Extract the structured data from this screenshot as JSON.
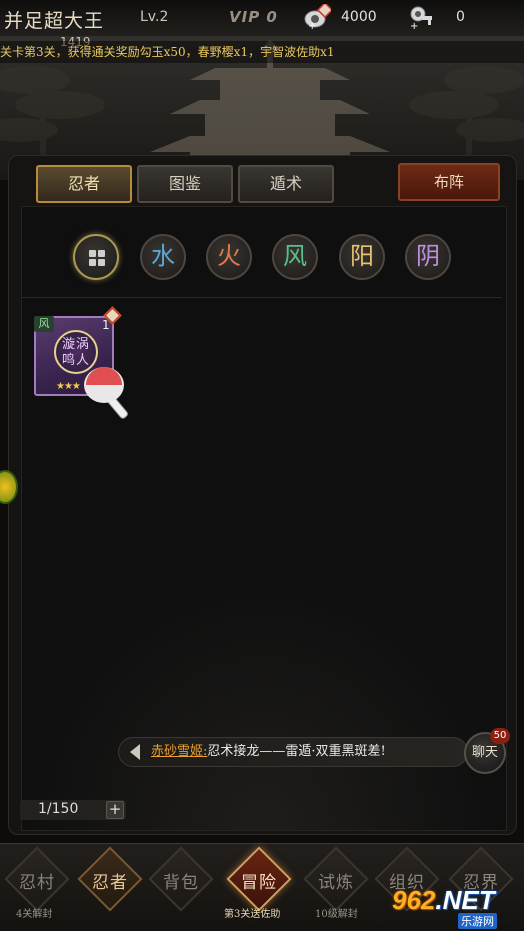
{
  "header": {
    "player_name": "并足超大王",
    "level": "Lv.2",
    "vip": "VIP 0",
    "coupon_icon": "coupon-plus-icon",
    "coupon_value": "4000",
    "key_icon": "key-plus-icon",
    "key_value": "0"
  },
  "marquee": {
    "count": "1419",
    "lead": "关卡第3关",
    "text": "，获得通关奖励勾玉x50，春野樱x1，宇智波佐助x1"
  },
  "tabs": [
    {
      "label": "忍者",
      "active": true
    },
    {
      "label": "图鉴",
      "active": false
    },
    {
      "label": "遁术",
      "active": false
    }
  ],
  "deploy_label": "布阵",
  "filters": [
    {
      "name": "all",
      "icon": "grid-icon",
      "glyph": ""
    },
    {
      "name": "water",
      "glyph": "水",
      "color": "#5aa8d8"
    },
    {
      "name": "fire",
      "glyph": "火",
      "color": "#e07a4a"
    },
    {
      "name": "wind",
      "glyph": "风",
      "color": "#5ac08a"
    },
    {
      "name": "yang",
      "glyph": "阳",
      "color": "#e8c070"
    },
    {
      "name": "yin",
      "glyph": "阴",
      "color": "#c090e0"
    }
  ],
  "ninja_card": {
    "element": "风",
    "level": "1",
    "name": "漩涡鸣人",
    "stars": 3,
    "stars_text": "★★★"
  },
  "chat": {
    "sender": "赤砂雪姬:",
    "message": "忍术接龙——雷遁·双重黑斑差!",
    "button_label": "聊天",
    "badge": "50"
  },
  "capacity": {
    "text": "1/150",
    "plus": "+"
  },
  "bottom_nav": [
    {
      "label": "忍村",
      "sub": "4关解封",
      "state": "normal"
    },
    {
      "label": "忍者",
      "sub": "",
      "state": "highlight"
    },
    {
      "label": "背包",
      "sub": "",
      "state": "normal"
    },
    {
      "label": "冒险",
      "sub": "第3关送佐助",
      "state": "active"
    },
    {
      "label": "试炼",
      "sub": "10级解封",
      "state": "normal"
    },
    {
      "label": "组织",
      "sub": "",
      "state": "normal"
    },
    {
      "label": "忍界",
      "sub": "",
      "state": "normal"
    }
  ],
  "watermark": {
    "logo_num": "962",
    "logo_suffix": ".NET",
    "sub": "乐游网"
  },
  "colors": {
    "accent_gold": "#b68c3c",
    "deploy_red": "#6e2a16",
    "card_purple": "#a37cc0",
    "chat_name": "#e8a030"
  }
}
